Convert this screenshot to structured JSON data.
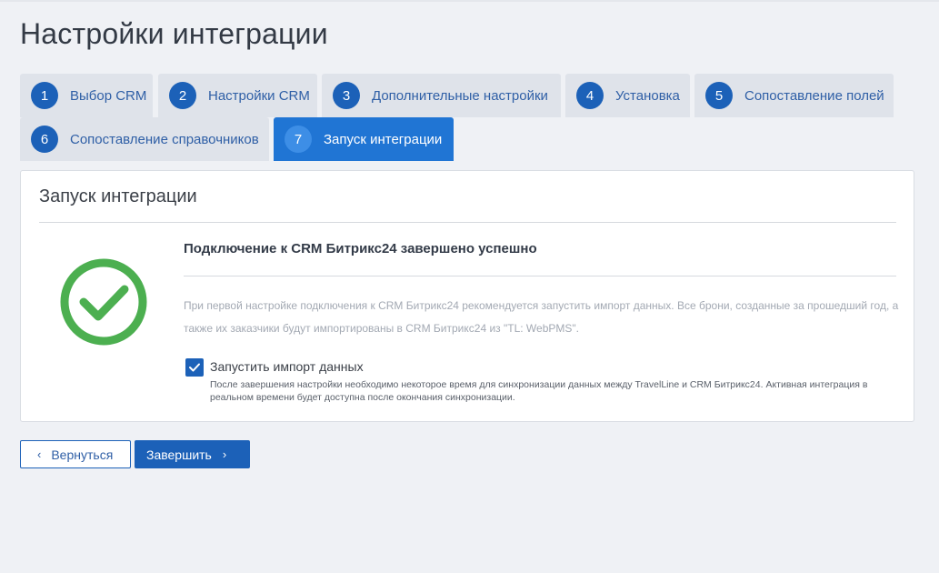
{
  "page": {
    "title": "Настройки интеграции"
  },
  "steps": [
    {
      "num": "1",
      "label": "Выбор CRM"
    },
    {
      "num": "2",
      "label": "Настройки CRM"
    },
    {
      "num": "3",
      "label": "Дополнительные настройки"
    },
    {
      "num": "4",
      "label": "Установка"
    },
    {
      "num": "5",
      "label": "Сопоставление полей"
    },
    {
      "num": "6",
      "label": "Сопоставление справочников"
    },
    {
      "num": "7",
      "label": "Запуск интеграции"
    }
  ],
  "active_step": "7",
  "card": {
    "title": "Запуск интеграции",
    "success_title": "Подключение к CRM Битрикс24 завершено успешно",
    "info": "При первой настройке подключения к CRM Битрикс24 рекомендуется запустить импорт данных. Все брони, созданные за прошедший год, а также их заказчики будут импортированы в CRM Битрикс24 из \"TL: WebPMS\".",
    "import_checkbox": {
      "label": "Запустить импорт данных",
      "checked": true,
      "description": "После завершения настройки необходимо некоторое время для синхронизации данных между TravelLine и CRM Битрикс24. Активная интеграция в реальном времени будет доступна после окончания синхронизации."
    }
  },
  "buttons": {
    "back": {
      "label": "Вернуться",
      "icon": "chevron-left-icon"
    },
    "finish": {
      "label": "Завершить",
      "icon": "chevron-right-icon"
    }
  },
  "colors": {
    "accent": "#1c61b8",
    "active_tab": "#2075d4",
    "success": "#4caf50",
    "background": "#eff1f5"
  }
}
